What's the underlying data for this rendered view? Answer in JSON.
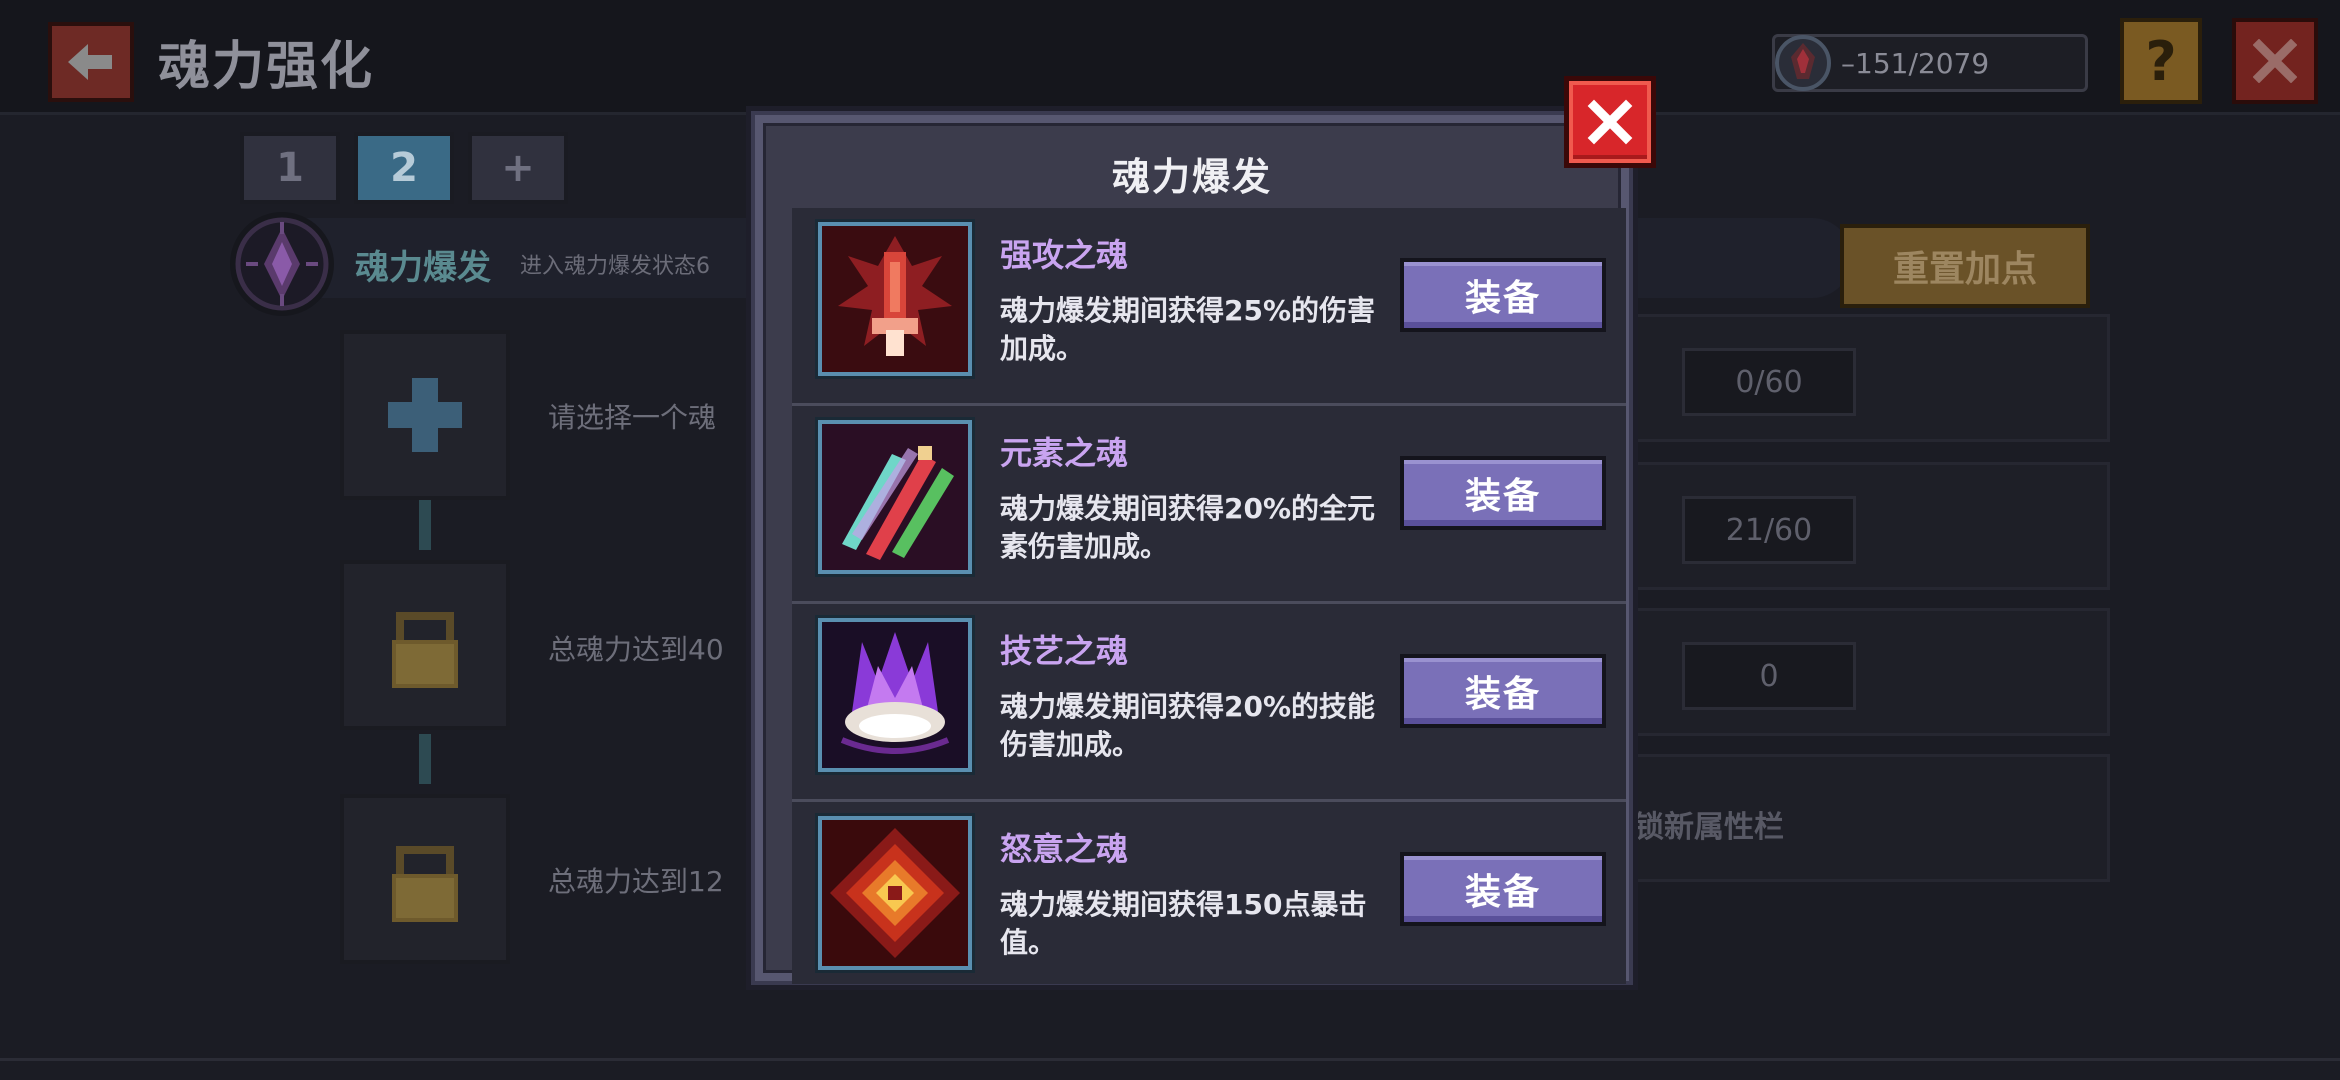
{
  "header": {
    "title": "魂力强化",
    "currency_text": "–151/2079",
    "help_label": "?"
  },
  "tabs": [
    {
      "label": "1"
    },
    {
      "label": "2"
    },
    {
      "label": "+"
    }
  ],
  "burst": {
    "name": "魂力爆发",
    "desc": "进入魂力爆发状态6",
    "reset_label": "重置加点"
  },
  "slots": [
    {
      "text": "请选择一个魂"
    },
    {
      "text": "总魂力达到40"
    },
    {
      "text": "总魂力达到12"
    }
  ],
  "stats": [
    "0/60",
    "21/60",
    "0"
  ],
  "unlock_text": "锁新属性栏",
  "modal": {
    "title": "魂力爆发",
    "equip_label": "装备",
    "items": [
      {
        "name": "强攻之魂",
        "desc": "魂力爆发期间获得25%的伤害加成。",
        "icon": "assault-soul-icon"
      },
      {
        "name": "元素之魂",
        "desc": "魂力爆发期间获得20%的全元素伤害加成。",
        "icon": "element-soul-icon"
      },
      {
        "name": "技艺之魂",
        "desc": "魂力爆发期间获得20%的技能伤害加成。",
        "icon": "skill-soul-icon"
      },
      {
        "name": "怒意之魂",
        "desc": "魂力爆发期间获得150点暴击值。",
        "icon": "rage-soul-icon"
      }
    ]
  },
  "colors": {
    "equip_button": "#7a70b8",
    "item_name": "#c9a4f0",
    "close_red": "#d8262a"
  }
}
